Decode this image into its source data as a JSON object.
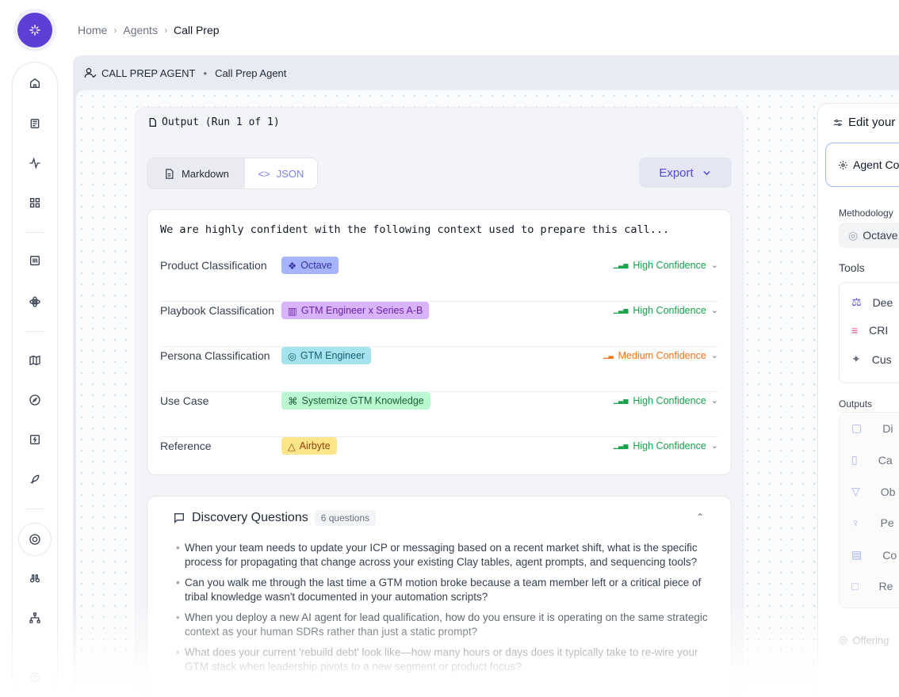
{
  "breadcrumb": {
    "home": "Home",
    "agents": "Agents",
    "current": "Call Prep"
  },
  "agent_header": {
    "type": "CALL PREP AGENT",
    "name": "Call Prep Agent"
  },
  "output": {
    "title": "Output (Run 1 of 1)",
    "tabs": {
      "markdown": "Markdown",
      "json": "JSON"
    },
    "export_label": "Export",
    "context_intro": "We are highly confident with the following context used to prepare this call...",
    "rows": [
      {
        "label": "Product Classification",
        "tag": "Octave",
        "confidence": "High Confidence"
      },
      {
        "label": "Playbook Classification",
        "tag": "GTM Engineer x Series A-B",
        "confidence": "High Confidence"
      },
      {
        "label": "Persona Classification",
        "tag": "GTM Engineer",
        "confidence": "Medium Confidence"
      },
      {
        "label": "Use Case",
        "tag": "Systemize GTM Knowledge",
        "confidence": "High Confidence"
      },
      {
        "label": "Reference",
        "tag": "Airbyte",
        "confidence": "High Confidence"
      }
    ]
  },
  "discovery": {
    "title": "Discovery Questions",
    "count": "6 questions",
    "questions": [
      "When your team needs to update your ICP or messaging based on a recent market shift, what is the specific process for propagating that change across your existing Clay tables, agent prompts, and sequencing tools?",
      "Can you walk me through the last time a GTM motion broke because a team member left or a critical piece of tribal knowledge wasn't documented in your automation scripts?",
      "When you deploy a new AI agent for lead qualification, how do you ensure it is operating on the same strategic context as your human SDRs rather than just a static prompt?",
      "What does your current 'rebuild debt' look like—how many hours or days does it typically take to re-wire your GTM stack when leadership pivots to a new segment or product focus?"
    ]
  },
  "edit_panel": {
    "title": "Edit your",
    "agent_config": "Agent Co",
    "methodology_label": "Methodology",
    "methodology_value": "Octave",
    "tools_label": "Tools",
    "tools": [
      "Dee",
      "CRI",
      "Cus"
    ],
    "outputs_label": "Outputs",
    "outputs": [
      "Di",
      "Ca",
      "Ob",
      "Pe",
      "Co",
      "Re"
    ],
    "offering": "Offering"
  },
  "colors": {
    "brand": "#5b3fd6",
    "accent": "#4f46e5",
    "high_conf": "#16a34a",
    "medium_conf": "#f97316",
    "tag_octave": "#a5b4fc",
    "tag_playbook": "#d8b4fe",
    "tag_persona": "#a5e4ee",
    "tag_usecase": "#bbf7d0",
    "tag_reference": "#fde68a"
  }
}
